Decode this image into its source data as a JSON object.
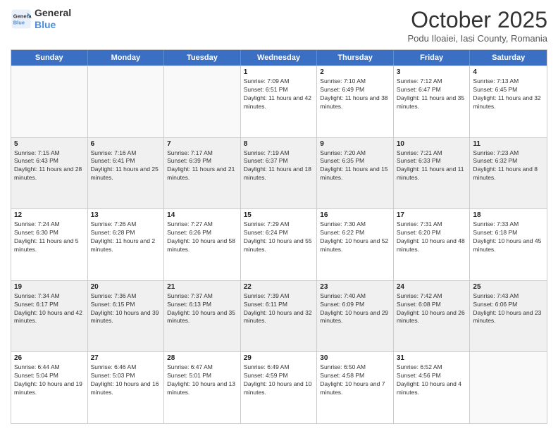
{
  "logo": {
    "line1": "General",
    "line2": "Blue"
  },
  "title": "October 2025",
  "subtitle": "Podu Iloaiei, Iasi County, Romania",
  "days_of_week": [
    "Sunday",
    "Monday",
    "Tuesday",
    "Wednesday",
    "Thursday",
    "Friday",
    "Saturday"
  ],
  "weeks": [
    [
      {
        "day": "",
        "sunrise": "",
        "sunset": "",
        "daylight": "",
        "empty": true
      },
      {
        "day": "",
        "sunrise": "",
        "sunset": "",
        "daylight": "",
        "empty": true
      },
      {
        "day": "",
        "sunrise": "",
        "sunset": "",
        "daylight": "",
        "empty": true
      },
      {
        "day": "1",
        "sunrise": "Sunrise: 7:09 AM",
        "sunset": "Sunset: 6:51 PM",
        "daylight": "Daylight: 11 hours and 42 minutes."
      },
      {
        "day": "2",
        "sunrise": "Sunrise: 7:10 AM",
        "sunset": "Sunset: 6:49 PM",
        "daylight": "Daylight: 11 hours and 38 minutes."
      },
      {
        "day": "3",
        "sunrise": "Sunrise: 7:12 AM",
        "sunset": "Sunset: 6:47 PM",
        "daylight": "Daylight: 11 hours and 35 minutes."
      },
      {
        "day": "4",
        "sunrise": "Sunrise: 7:13 AM",
        "sunset": "Sunset: 6:45 PM",
        "daylight": "Daylight: 11 hours and 32 minutes."
      }
    ],
    [
      {
        "day": "5",
        "sunrise": "Sunrise: 7:15 AM",
        "sunset": "Sunset: 6:43 PM",
        "daylight": "Daylight: 11 hours and 28 minutes."
      },
      {
        "day": "6",
        "sunrise": "Sunrise: 7:16 AM",
        "sunset": "Sunset: 6:41 PM",
        "daylight": "Daylight: 11 hours and 25 minutes."
      },
      {
        "day": "7",
        "sunrise": "Sunrise: 7:17 AM",
        "sunset": "Sunset: 6:39 PM",
        "daylight": "Daylight: 11 hours and 21 minutes."
      },
      {
        "day": "8",
        "sunrise": "Sunrise: 7:19 AM",
        "sunset": "Sunset: 6:37 PM",
        "daylight": "Daylight: 11 hours and 18 minutes."
      },
      {
        "day": "9",
        "sunrise": "Sunrise: 7:20 AM",
        "sunset": "Sunset: 6:35 PM",
        "daylight": "Daylight: 11 hours and 15 minutes."
      },
      {
        "day": "10",
        "sunrise": "Sunrise: 7:21 AM",
        "sunset": "Sunset: 6:33 PM",
        "daylight": "Daylight: 11 hours and 11 minutes."
      },
      {
        "day": "11",
        "sunrise": "Sunrise: 7:23 AM",
        "sunset": "Sunset: 6:32 PM",
        "daylight": "Daylight: 11 hours and 8 minutes."
      }
    ],
    [
      {
        "day": "12",
        "sunrise": "Sunrise: 7:24 AM",
        "sunset": "Sunset: 6:30 PM",
        "daylight": "Daylight: 11 hours and 5 minutes."
      },
      {
        "day": "13",
        "sunrise": "Sunrise: 7:26 AM",
        "sunset": "Sunset: 6:28 PM",
        "daylight": "Daylight: 11 hours and 2 minutes."
      },
      {
        "day": "14",
        "sunrise": "Sunrise: 7:27 AM",
        "sunset": "Sunset: 6:26 PM",
        "daylight": "Daylight: 10 hours and 58 minutes."
      },
      {
        "day": "15",
        "sunrise": "Sunrise: 7:29 AM",
        "sunset": "Sunset: 6:24 PM",
        "daylight": "Daylight: 10 hours and 55 minutes."
      },
      {
        "day": "16",
        "sunrise": "Sunrise: 7:30 AM",
        "sunset": "Sunset: 6:22 PM",
        "daylight": "Daylight: 10 hours and 52 minutes."
      },
      {
        "day": "17",
        "sunrise": "Sunrise: 7:31 AM",
        "sunset": "Sunset: 6:20 PM",
        "daylight": "Daylight: 10 hours and 48 minutes."
      },
      {
        "day": "18",
        "sunrise": "Sunrise: 7:33 AM",
        "sunset": "Sunset: 6:18 PM",
        "daylight": "Daylight: 10 hours and 45 minutes."
      }
    ],
    [
      {
        "day": "19",
        "sunrise": "Sunrise: 7:34 AM",
        "sunset": "Sunset: 6:17 PM",
        "daylight": "Daylight: 10 hours and 42 minutes."
      },
      {
        "day": "20",
        "sunrise": "Sunrise: 7:36 AM",
        "sunset": "Sunset: 6:15 PM",
        "daylight": "Daylight: 10 hours and 39 minutes."
      },
      {
        "day": "21",
        "sunrise": "Sunrise: 7:37 AM",
        "sunset": "Sunset: 6:13 PM",
        "daylight": "Daylight: 10 hours and 35 minutes."
      },
      {
        "day": "22",
        "sunrise": "Sunrise: 7:39 AM",
        "sunset": "Sunset: 6:11 PM",
        "daylight": "Daylight: 10 hours and 32 minutes."
      },
      {
        "day": "23",
        "sunrise": "Sunrise: 7:40 AM",
        "sunset": "Sunset: 6:09 PM",
        "daylight": "Daylight: 10 hours and 29 minutes."
      },
      {
        "day": "24",
        "sunrise": "Sunrise: 7:42 AM",
        "sunset": "Sunset: 6:08 PM",
        "daylight": "Daylight: 10 hours and 26 minutes."
      },
      {
        "day": "25",
        "sunrise": "Sunrise: 7:43 AM",
        "sunset": "Sunset: 6:06 PM",
        "daylight": "Daylight: 10 hours and 23 minutes."
      }
    ],
    [
      {
        "day": "26",
        "sunrise": "Sunrise: 6:44 AM",
        "sunset": "Sunset: 5:04 PM",
        "daylight": "Daylight: 10 hours and 19 minutes."
      },
      {
        "day": "27",
        "sunrise": "Sunrise: 6:46 AM",
        "sunset": "Sunset: 5:03 PM",
        "daylight": "Daylight: 10 hours and 16 minutes."
      },
      {
        "day": "28",
        "sunrise": "Sunrise: 6:47 AM",
        "sunset": "Sunset: 5:01 PM",
        "daylight": "Daylight: 10 hours and 13 minutes."
      },
      {
        "day": "29",
        "sunrise": "Sunrise: 6:49 AM",
        "sunset": "Sunset: 4:59 PM",
        "daylight": "Daylight: 10 hours and 10 minutes."
      },
      {
        "day": "30",
        "sunrise": "Sunrise: 6:50 AM",
        "sunset": "Sunset: 4:58 PM",
        "daylight": "Daylight: 10 hours and 7 minutes."
      },
      {
        "day": "31",
        "sunrise": "Sunrise: 6:52 AM",
        "sunset": "Sunset: 4:56 PM",
        "daylight": "Daylight: 10 hours and 4 minutes."
      },
      {
        "day": "",
        "sunrise": "",
        "sunset": "",
        "daylight": "",
        "empty": true
      }
    ]
  ]
}
